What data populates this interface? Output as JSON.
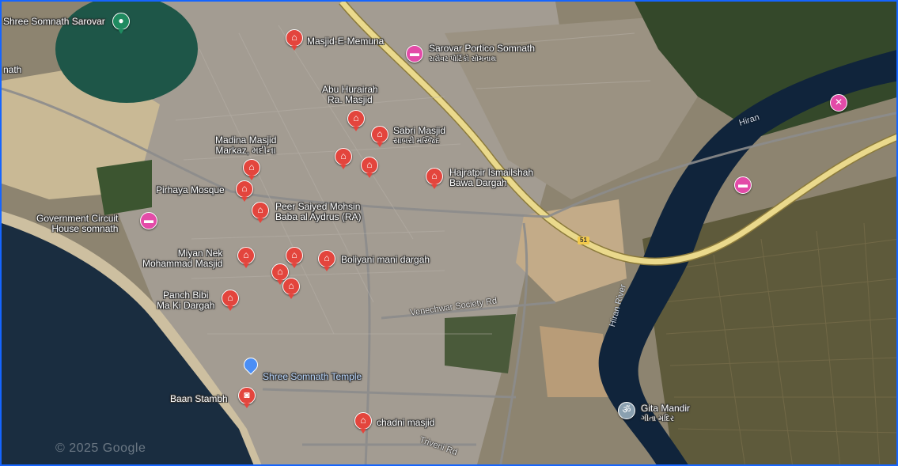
{
  "map": {
    "colors": {
      "sea": "#1a2d40",
      "sand": "#cdbfa0",
      "land": "#8d8470",
      "urban": "#a8a29a",
      "highway": "#e8d98a",
      "river": "#10243b",
      "farm": "#5b5a3a",
      "vegetation": "#2f4a26",
      "lake": "#1d5a4a"
    },
    "highway_shield": "51",
    "watermark": "© 2025 Google",
    "places": {
      "shree_somnath_sarovar": "Shree Somnath Sarovar",
      "nath": "nath",
      "masjid_e_memuna": "Masjid-E-Memuna",
      "sarovar_portico": "Sarovar Portico Somnath",
      "sarovar_portico_gu": "સરોવર પોર્ટિકો સોમનાથ",
      "abu_huraira_1": "Abu Hurairah",
      "abu_huraira_2": "Ra. Masjid",
      "sabri_masjid": "Sabri Masjid",
      "sabri_masjid_gu": "સાબરી મસ્જિદ",
      "madina_masjid_1": "Madina Masjid",
      "madina_masjid_2": "Markaz, મદીના",
      "hajratpir_1": "Hajratpir Ismailshah",
      "hajratpir_2": "Bawa Dargah",
      "pirhaya_mosque": "Pirhaya Mosque",
      "peer_saiyed_1": "Peer Saiyed Mohsin",
      "peer_saiyed_2": "Baba al Aydrus (RA)",
      "govt_circuit_1": "Government Circuit",
      "govt_circuit_2": "House somnath",
      "miyan_nek_1": "Miyan Nek",
      "miyan_nek_2": "Mohammad Masjid",
      "boliyani": "Boliyani mani dargah",
      "panch_bibi_1": "Panch Bibi",
      "panch_bibi_2": "Ma Ki Dargah",
      "shree_somnath_temple": "Shree Somnath Temple",
      "baan_stambh": "Baan Stambh",
      "chadni_masjid": "chadni masjid",
      "gita_mandir": "Gita Mandir",
      "gita_mandir_gu": "ગીતા મંદિર",
      "hiran": "Hiran",
      "hiran_river": "Hiran River",
      "venechwar_road": "Venechwar Society Rd",
      "triveni_rd": "Triveni Rd"
    },
    "icons": {
      "mosque": "mosque-icon",
      "hotel": "hotel-icon",
      "park": "park-icon",
      "camera": "camera-icon",
      "temple": "temple-icon",
      "location": "location-pin-icon"
    }
  }
}
